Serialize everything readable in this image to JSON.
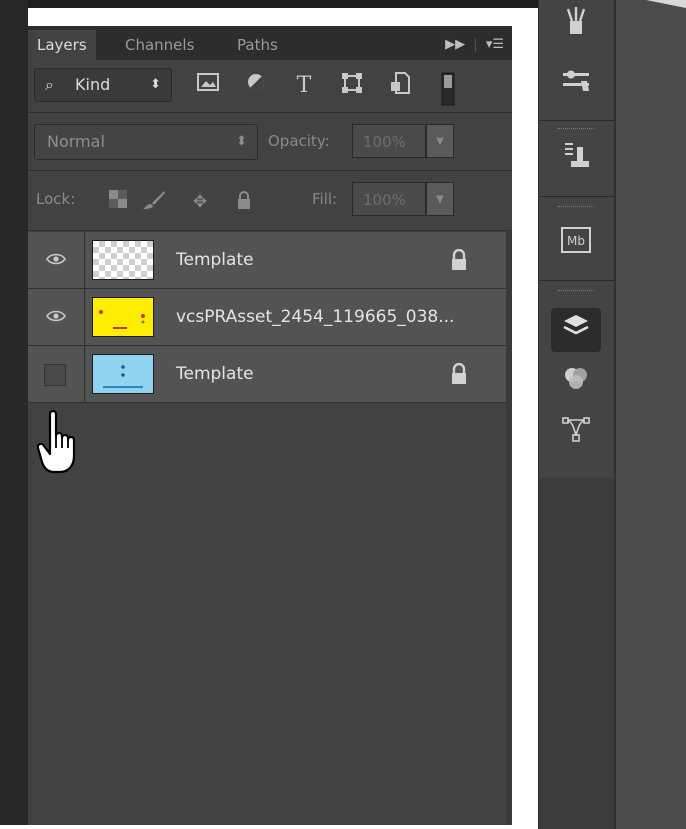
{
  "tabs": [
    "Layers",
    "Channels",
    "Paths"
  ],
  "filter": {
    "kind_label": "Kind",
    "icons": [
      "image-filter-icon",
      "adjustment-filter-icon",
      "type-filter-icon",
      "shape-filter-icon",
      "smart-object-filter-icon",
      "filter-toggle-icon"
    ]
  },
  "blend": {
    "mode": "Normal",
    "opacity_label": "Opacity:",
    "opacity_value": "100%"
  },
  "lock": {
    "label": "Lock:",
    "fill_label": "Fill:",
    "fill_value": "100%"
  },
  "layers": [
    {
      "name": "Template",
      "visible": true,
      "locked": true,
      "thumb": "transparent"
    },
    {
      "name": "vcsPRAsset_2454_119665_038...",
      "visible": true,
      "locked": false,
      "thumb": "yellow"
    },
    {
      "name": "Template",
      "visible": false,
      "locked": true,
      "thumb": "blue"
    }
  ],
  "dock_icons": [
    "brush-presets-icon",
    "adjustment-sliders-icon",
    "clone-source-icon",
    "mb-icon",
    "layers-icon",
    "channels-icon",
    "paths-icon"
  ],
  "colors": {
    "panel_bg": "#424242",
    "layer_row_bg": "#535353",
    "yellow_thumb": "#ffee00",
    "blue_thumb": "#8fd3f1"
  }
}
